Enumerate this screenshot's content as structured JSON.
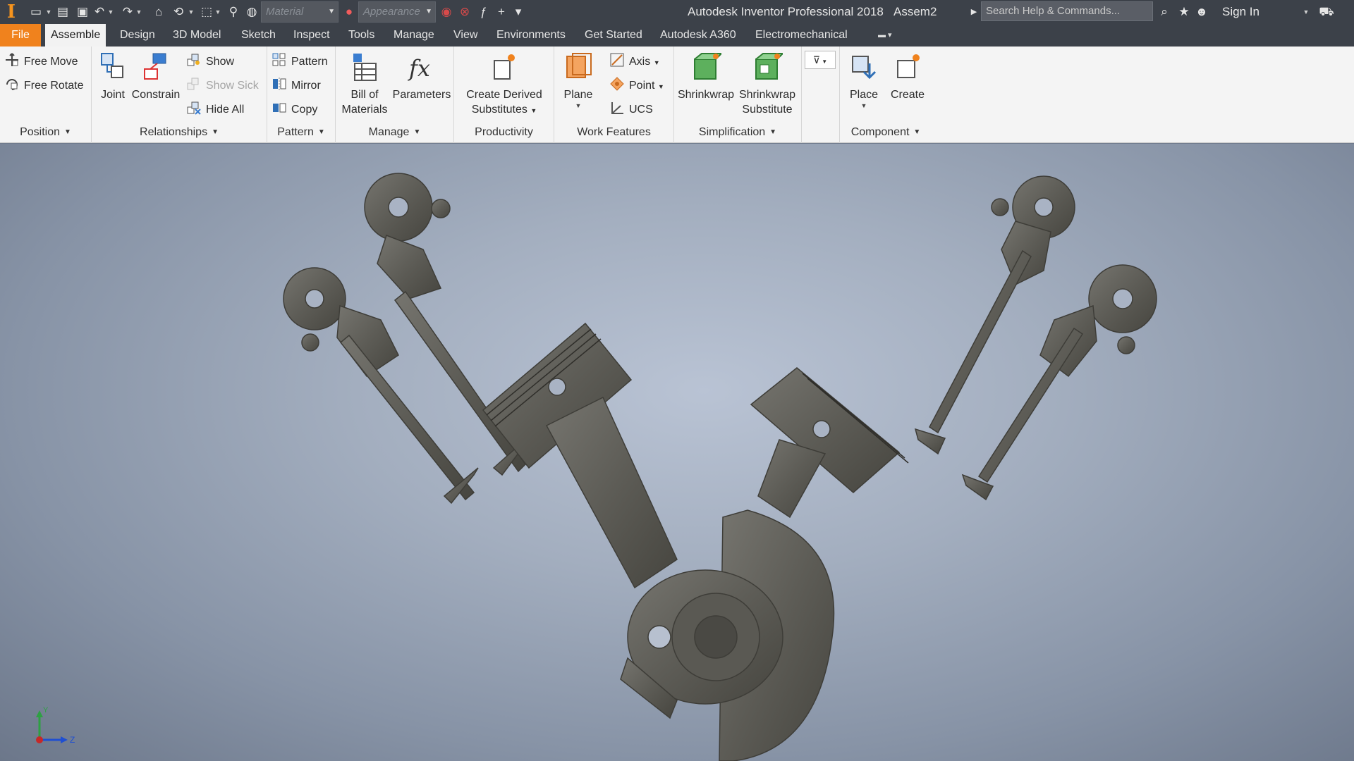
{
  "app": {
    "title": "Autodesk Inventor Professional 2018",
    "document": "Assem2"
  },
  "quick_access": {
    "material_placeholder": "Material",
    "appearance_placeholder": "Appearance",
    "search_placeholder": "Search Help & Commands...",
    "sign_in": "Sign In"
  },
  "tabs": [
    {
      "label": "File"
    },
    {
      "label": "Assemble"
    },
    {
      "label": "Design"
    },
    {
      "label": "3D Model"
    },
    {
      "label": "Sketch"
    },
    {
      "label": "Inspect"
    },
    {
      "label": "Tools"
    },
    {
      "label": "Manage"
    },
    {
      "label": "View"
    },
    {
      "label": "Environments"
    },
    {
      "label": "Get Started"
    },
    {
      "label": "Autodesk A360"
    },
    {
      "label": "Electromechanical"
    }
  ],
  "ribbon": {
    "position": {
      "title": "Position",
      "free_move": "Free Move",
      "free_rotate": "Free Rotate"
    },
    "relationships": {
      "title": "Relationships",
      "joint": "Joint",
      "constrain": "Constrain",
      "show": "Show",
      "show_sick": "Show Sick",
      "hide_all": "Hide All"
    },
    "pattern": {
      "title": "Pattern",
      "pattern": "Pattern",
      "mirror": "Mirror",
      "copy": "Copy"
    },
    "manage": {
      "title": "Manage",
      "bom_line1": "Bill of",
      "bom_line2": "Materials",
      "parameters": "Parameters"
    },
    "productivity": {
      "title": "Productivity",
      "derived_line1": "Create Derived",
      "derived_line2": "Substitutes"
    },
    "work_features": {
      "title": "Work Features",
      "plane": "Plane",
      "axis": "Axis",
      "point": "Point",
      "ucs": "UCS"
    },
    "simplification": {
      "title": "Simplification",
      "shrinkwrap": "Shrinkwrap",
      "shrinkwrap_sub_line1": "Shrinkwrap",
      "shrinkwrap_sub_line2": "Substitute"
    },
    "component": {
      "title": "Component",
      "place": "Place",
      "create": "Create"
    }
  },
  "triad": {
    "y_label": "Y",
    "z_label": "Z"
  },
  "colors": {
    "accent": "#f0821d",
    "title_bar": "#3c4149",
    "ribbon": "#f4f4f4",
    "model": "#5d5c56"
  }
}
